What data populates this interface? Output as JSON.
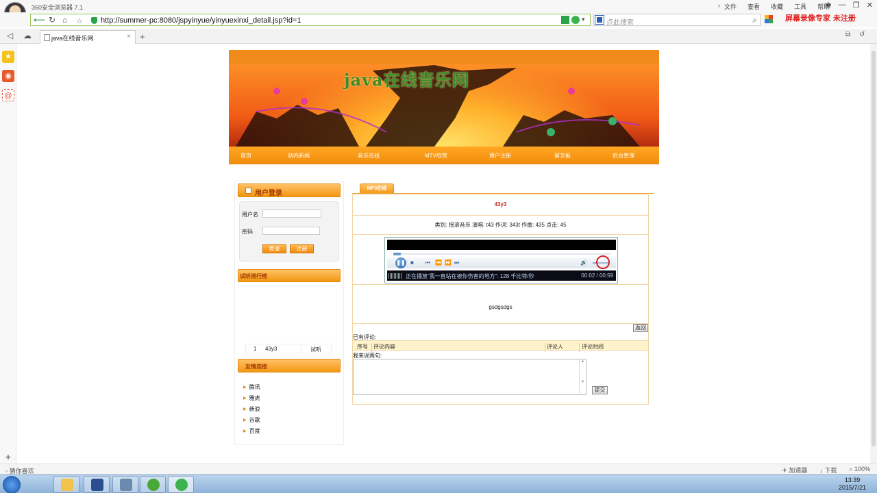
{
  "browser": {
    "name": "360安全浏览器 7.1",
    "menu": [
      "文件",
      "查看",
      "收藏",
      "工具",
      "帮助"
    ],
    "url": "http://summer-pc:8080/jspyinyue/yinyuexinxi_detail.jsp?id=1",
    "search_placeholder": "点此搜索",
    "recorder_text": "屏幕录像专家  未注册",
    "tab_title": "java在线音乐网",
    "status_left": "猜你喜欢",
    "status_items": [
      "加速器",
      "下载",
      "100%"
    ],
    "clock_time": "13:39",
    "clock_date": "2015/7/21"
  },
  "site": {
    "banner_title": "java在线音乐网",
    "nav": [
      "首页",
      "站内新闻",
      "音乐在线",
      "MTV欣赏",
      "用户注册",
      "留言板",
      "后台管理"
    ]
  },
  "login": {
    "heading": "用户登录",
    "username_label": "用户名",
    "password_label": "密码",
    "login_button": "登录",
    "register_button": "注册"
  },
  "ranking": {
    "heading": "试听排行榜",
    "rows": [
      {
        "index": "1",
        "name": "43y3",
        "action": "试听"
      }
    ]
  },
  "links": {
    "heading": "友情连接",
    "items": [
      "腾讯",
      "雅虎",
      "新浪",
      "谷歌",
      "百度"
    ]
  },
  "detail": {
    "tab": "MP3在线",
    "song_title": "43y3",
    "meta": "类别: 摇滚音乐  演唱: t43  作词: 343t  作曲: 435  点击: 45",
    "player": {
      "now_playing": "正在播放“我一直站在被你伤害的地方”: 128 千比特/秒",
      "time": "00:02 / 00:59",
      "progress": 0.034
    },
    "description": "gsdgsdgs",
    "back_button": "返回",
    "comments_label": "已有评论:",
    "comment_columns": [
      "序号",
      "评论内容",
      "评论人",
      "评论时间"
    ],
    "say_label": "我来说两句:",
    "submit_button": "提交"
  }
}
